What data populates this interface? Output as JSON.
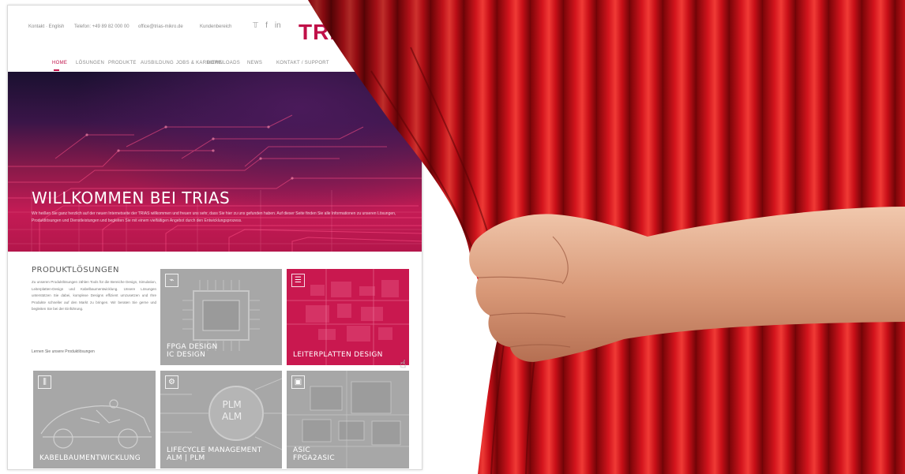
{
  "topbar": {
    "contacts": [
      "Kontakt · English",
      "Telefon: +49 89 82 000 00",
      "office@trias-mikro.de",
      "Kundenbereich"
    ],
    "social_icons": [
      "twitter-icon",
      "facebook-icon",
      "linkedin-icon"
    ],
    "logo_text": "TRI"
  },
  "nav": {
    "items": [
      "HOME",
      "LÖSUNGEN",
      "PRODUKTE",
      "AUSBILDUNG",
      "JOBS & KARRIERE",
      "DOWNLOADS",
      "NEWS",
      "KONTAKT / SUPPORT"
    ],
    "active_index": 0
  },
  "hero": {
    "title": "WILLKOMMEN BEI TRIAS",
    "text": "Wir heißen Sie ganz herzlich auf der neuen Internetseite der TRIAS willkommen und freuen uns sehr, dass Sie hier zu uns gefunden haben. Auf dieser Seite finden Sie alle Informationen zu unseren Lösungen, Produktlösungen und Dienstleistungen und begleiten Sie mit einem vielfältigen Angebot durch den Entwicklungsprozess."
  },
  "products": {
    "heading": "PRODUKTLÖSUNGEN",
    "text": "Zu unseren Produktlösungen zählen Tools für die Bereiche Design, Simulation, Leiterplatten-Design und Kabelbaumentwicklung. Unsere Lösungen unterstützen Sie dabei, komplexe Designs effizient umzusetzen und Ihre Produkte schneller auf den Markt zu bringen. Wir beraten Sie gerne und begleiten Sie bei der Einführung.",
    "link": "Lernen Sie unsere Produktlösungen",
    "tiles": [
      {
        "label_1": "FPGA DESIGN",
        "label_2": "IC DESIGN",
        "icon": "chip-power-icon",
        "highlight": false
      },
      {
        "label_1": "LEITERPLATTEN DESIGN",
        "label_2": "",
        "icon": "board-icon",
        "highlight": true
      },
      {
        "label_1": "KABELBAUMENTWICKLUNG",
        "label_2": "",
        "icon": "cable-icon",
        "highlight": false
      },
      {
        "label_1": "LIFECYCLE MANAGEMENT",
        "label_2": "ALM | PLM",
        "icon": "lifecycle-icon",
        "highlight": false,
        "overlay_1": "PLM",
        "overlay_2": "ALM"
      },
      {
        "label_1": "ASIC",
        "label_2": "FPGA2ASIC",
        "icon": "asic-icon",
        "highlight": false
      }
    ]
  },
  "colors": {
    "brand": "#c01048",
    "curtain": "#c8101a",
    "tile_grey": "#a7a7a7"
  }
}
